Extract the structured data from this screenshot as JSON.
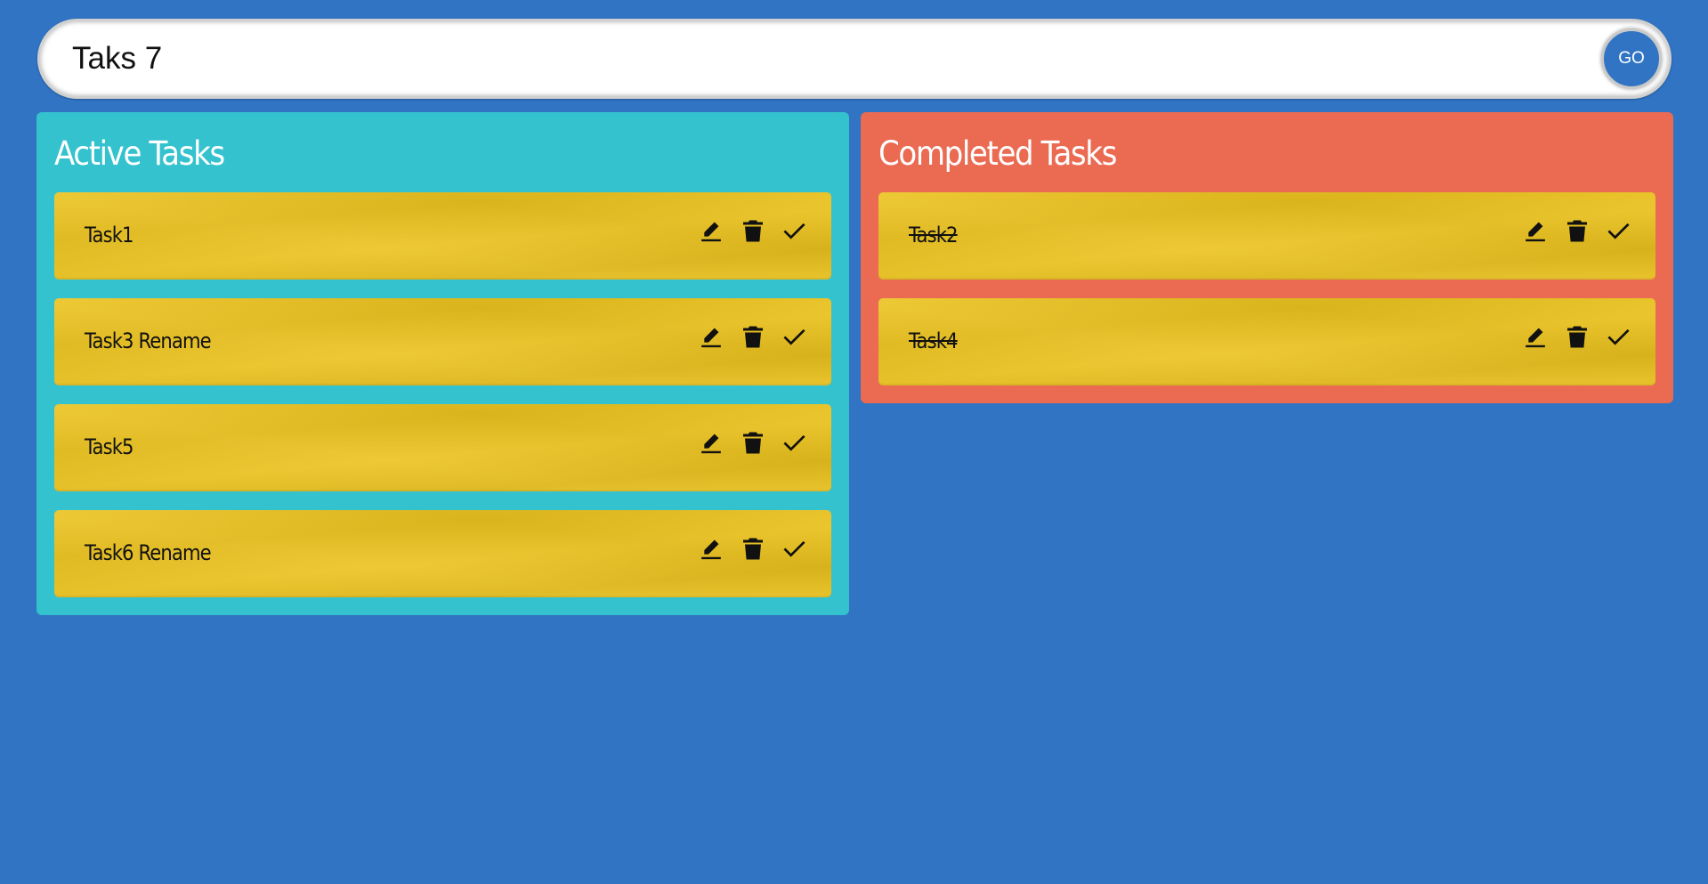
{
  "search": {
    "value": "Taks 7",
    "go_label": "GO"
  },
  "active": {
    "title": "Active Tasks",
    "tasks": [
      {
        "label": "Task1"
      },
      {
        "label": "Task3 Rename"
      },
      {
        "label": "Task5"
      },
      {
        "label": "Task6 Rename"
      }
    ]
  },
  "completed": {
    "title": "Completed Tasks",
    "tasks": [
      {
        "label": "Task2"
      },
      {
        "label": "Task4"
      }
    ]
  },
  "icons": {
    "edit": "pencil-icon",
    "delete": "trash-icon",
    "complete": "check-icon"
  },
  "colors": {
    "background": "#3074c3",
    "active_panel": "#34c2ce",
    "completed_panel": "#eb6a52",
    "task_card": "#ecc31e"
  }
}
